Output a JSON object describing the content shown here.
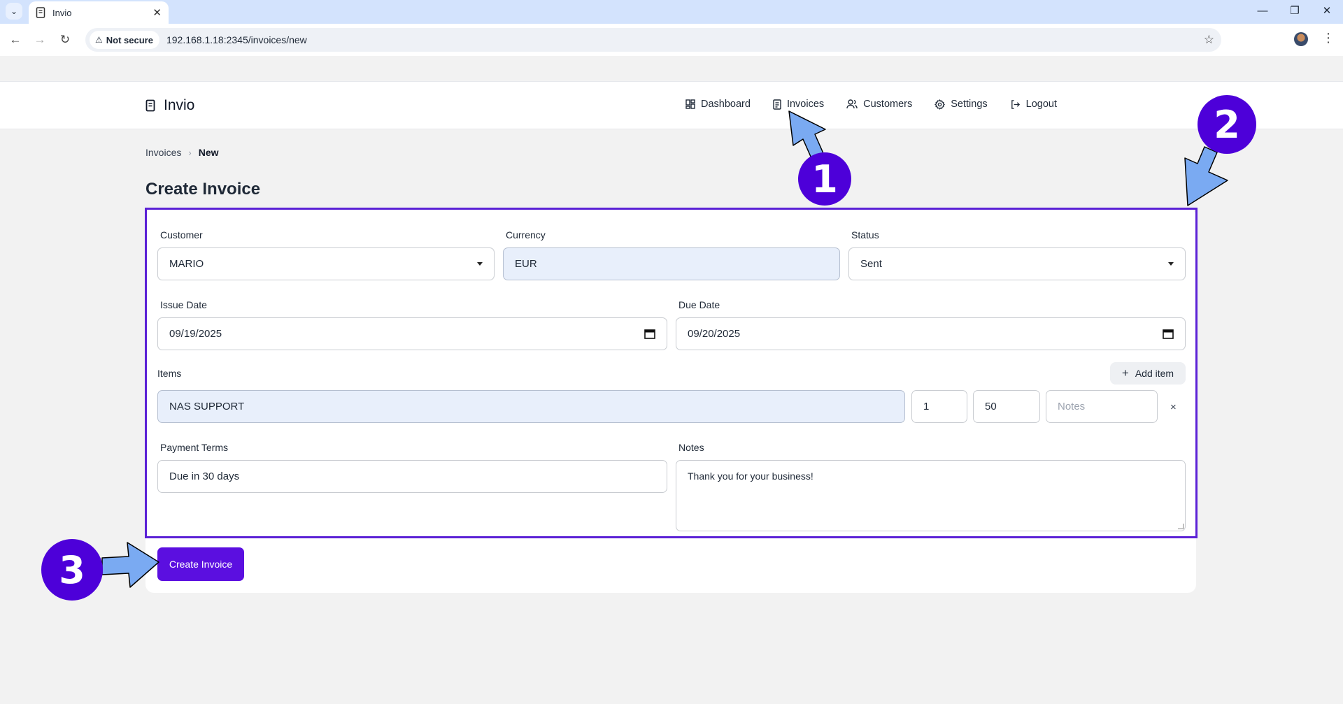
{
  "browser": {
    "tab_title": "Invio",
    "security_label": "Not secure",
    "url": "192.168.1.18:2345/invoices/new",
    "icons": [
      "chevron-down-icon",
      "close-icon",
      "back-icon",
      "forward-icon",
      "reload-icon",
      "warning-icon",
      "star-icon",
      "avatar",
      "more-icon"
    ]
  },
  "app": {
    "brand": "Invio",
    "nav": [
      {
        "label": "Dashboard",
        "icon": "dashboard-icon"
      },
      {
        "label": "Invoices",
        "icon": "invoice-icon"
      },
      {
        "label": "Customers",
        "icon": "users-icon"
      },
      {
        "label": "Settings",
        "icon": "gear-icon"
      },
      {
        "label": "Logout",
        "icon": "logout-icon"
      }
    ]
  },
  "breadcrumb": {
    "parent": "Invoices",
    "separator": "›",
    "current": "New"
  },
  "page_title": "Create Invoice",
  "form": {
    "customer": {
      "label": "Customer",
      "value": "MARIO"
    },
    "currency": {
      "label": "Currency",
      "value": "EUR"
    },
    "status": {
      "label": "Status",
      "value": "Sent"
    },
    "issue_date": {
      "label": "Issue Date",
      "value": "09/19/2025"
    },
    "due_date": {
      "label": "Due Date",
      "value": "09/20/2025"
    },
    "items": {
      "label": "Items",
      "add_label": "Add item",
      "rows": [
        {
          "description": "NAS SUPPORT",
          "quantity": "1",
          "price": "50",
          "notes_placeholder": "Notes",
          "remove": "×"
        }
      ]
    },
    "payment_terms": {
      "label": "Payment Terms",
      "value": "Due in 30 days"
    },
    "notes": {
      "label": "Notes",
      "value": "Thank you for your business!"
    },
    "submit_label": "Create Invoice"
  },
  "annotations": {
    "markers": [
      "1",
      "2",
      "3"
    ],
    "accent": "#4d00d9",
    "arrow_color": "#7aaaf2"
  }
}
